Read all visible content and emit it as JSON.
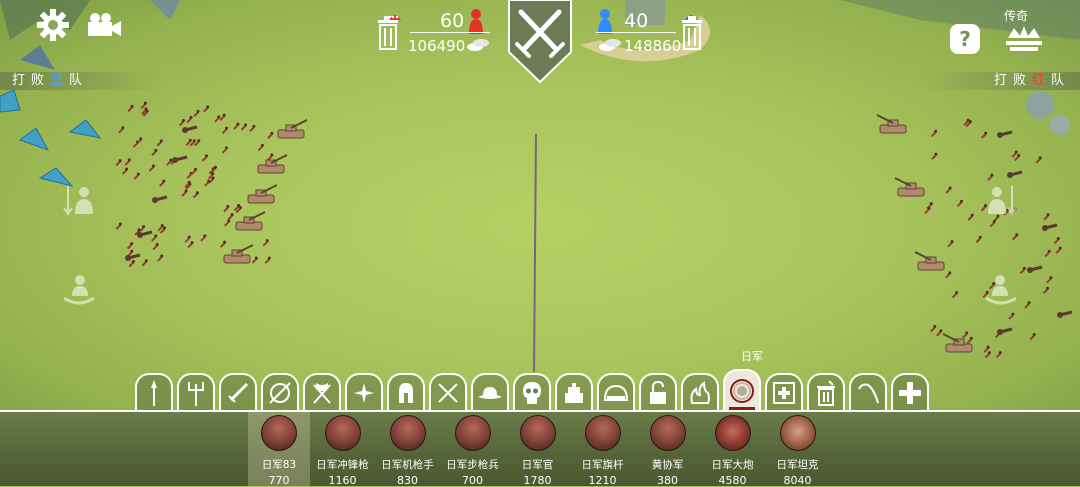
{
  "hud": {
    "settings_icon": "gear-icon",
    "camera_icon": "video-camera-icon",
    "left_label_prefix": "打败",
    "left_label_color_word": "蓝",
    "left_label_suffix": "队",
    "right_label_prefix": "打败",
    "right_label_color_word": "红",
    "right_label_suffix": "队",
    "help_icon": "question-icon",
    "legend_label": "传奇",
    "legend_icon": "crown-icon"
  },
  "red_team": {
    "unit_count": "60",
    "money": "106490",
    "color": "#ff3a2e"
  },
  "blue_team": {
    "unit_count": "40",
    "money": "148860",
    "color": "#2f8cff"
  },
  "categories": {
    "selected_label": "日军",
    "tabs": [
      {
        "icon": "spear-icon"
      },
      {
        "icon": "trident-icon"
      },
      {
        "icon": "sword-icon"
      },
      {
        "icon": "shield-icon"
      },
      {
        "icon": "viking-axes-icon"
      },
      {
        "icon": "shuriken-icon"
      },
      {
        "icon": "spartan-helmet-icon"
      },
      {
        "icon": "crossed-swords-icon"
      },
      {
        "icon": "cowboy-hat-icon"
      },
      {
        "icon": "skull-icon"
      },
      {
        "icon": "castle-icon"
      },
      {
        "icon": "dome-icon"
      },
      {
        "icon": "unlock-icon"
      },
      {
        "icon": "flame-icon"
      },
      {
        "icon": "japanese-army-icon",
        "active": true
      },
      {
        "icon": "medkit-icon"
      },
      {
        "icon": "trash-can-icon"
      },
      {
        "icon": "hook-icon"
      },
      {
        "icon": "plus-icon"
      }
    ]
  },
  "units": [
    {
      "name": "日军83",
      "cost": "770"
    },
    {
      "name": "日军冲锋枪",
      "cost": "1160"
    },
    {
      "name": "日军机枪手",
      "cost": "830"
    },
    {
      "name": "日军步枪兵",
      "cost": "700"
    },
    {
      "name": "日军官",
      "cost": "1780"
    },
    {
      "name": "日军旗杆",
      "cost": "1210"
    },
    {
      "name": "黄协军",
      "cost": "380"
    },
    {
      "name": "日军大炮",
      "cost": "4580"
    },
    {
      "name": "日军坦克",
      "cost": "8040"
    }
  ],
  "colors": {
    "grass": "#a9c45c",
    "center_line": "#5a4a8a",
    "red_units": "#9a3a34",
    "tank": "#b08a6a"
  }
}
